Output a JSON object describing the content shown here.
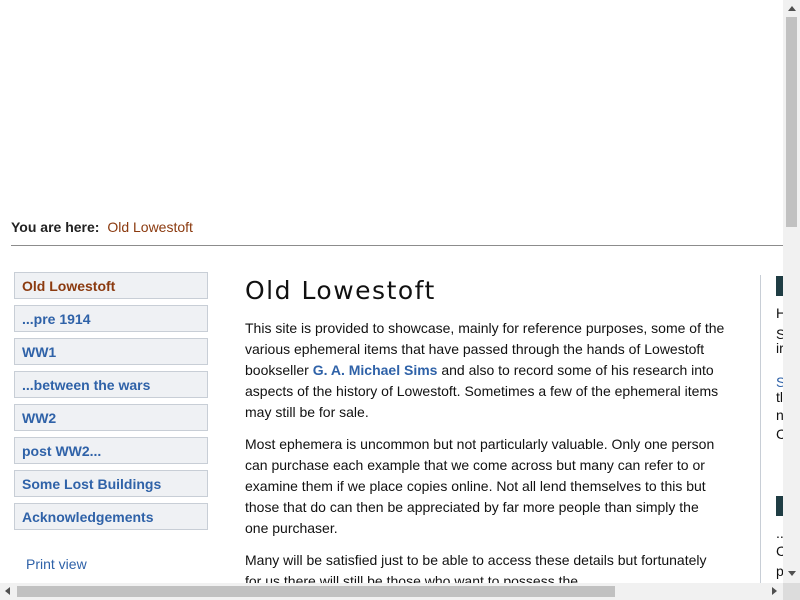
{
  "breadcrumb": {
    "label": "You are here:",
    "current": "Old Lowestoft"
  },
  "nav": {
    "items": [
      {
        "label": "Old Lowestoft",
        "active": true
      },
      {
        "label": "...pre 1914"
      },
      {
        "label": "WW1"
      },
      {
        "label": "...between the wars"
      },
      {
        "label": "WW2"
      },
      {
        "label": "post WW2..."
      },
      {
        "label": "Some Lost Buildings"
      },
      {
        "label": "Acknowledgements"
      }
    ],
    "print_view": "Print view"
  },
  "main": {
    "title": "Old Lowestoft",
    "p1_before": "This site is provided to showcase, mainly for reference purposes, some of the various ephemeral items that have passed through the hands of Lowestoft bookseller ",
    "p1_link": "G. A. Michael Sims",
    "p1_after": " and also to record some of his research into aspects of the history of Lowestoft. Sometimes a few of the ephemeral items may still be for sale.",
    "p2": "Most ephemera is uncommon but not particularly valuable. Only one person can purchase each example that we come across but many can refer to or examine them if we place copies online. Not all lend themselves to this but those that do can then be appreciated by far more people than simply the one purchaser.",
    "p3": "Many will be satisfied just to be able to access these details but fortunately for us there will still be those who want to possess the"
  },
  "right_column": {
    "frags": [
      "H",
      "S",
      "ir",
      "S",
      "tl",
      "n",
      "C",
      "...",
      "C",
      "p"
    ]
  },
  "colors": {
    "link": "#2f62a8",
    "active": "#8b3a0f",
    "accent_block": "#1f3d44"
  }
}
